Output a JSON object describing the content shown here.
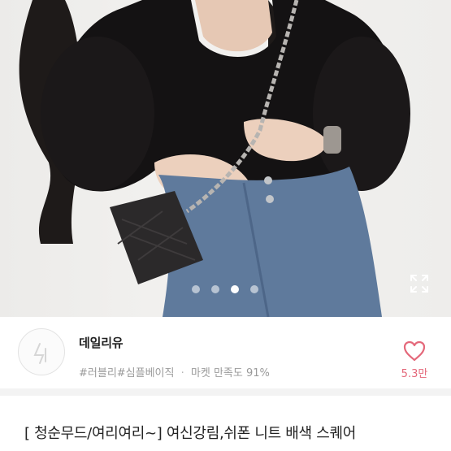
{
  "product_image": {
    "alt": "product-photo",
    "carousel_count": 4,
    "carousel_active_index": 2
  },
  "seller": {
    "name": "데일리유",
    "tags": [
      "#러블리",
      "#심플베이직"
    ],
    "satisfaction_label": "마켓 만족도",
    "satisfaction_value": "91%",
    "like_count": "5.3만"
  },
  "product": {
    "title": "[ 청순무드/여리여리~] 여신강림,쉬폰 니트 배색 스퀘어"
  },
  "colors": {
    "like_accent": "#e4687a",
    "tag_text": "#9a9a9a"
  },
  "icons": {
    "expand": "expand-arrows-icon",
    "like": "heart-outline-icon",
    "seller_logo": "seller-logo-icon"
  }
}
